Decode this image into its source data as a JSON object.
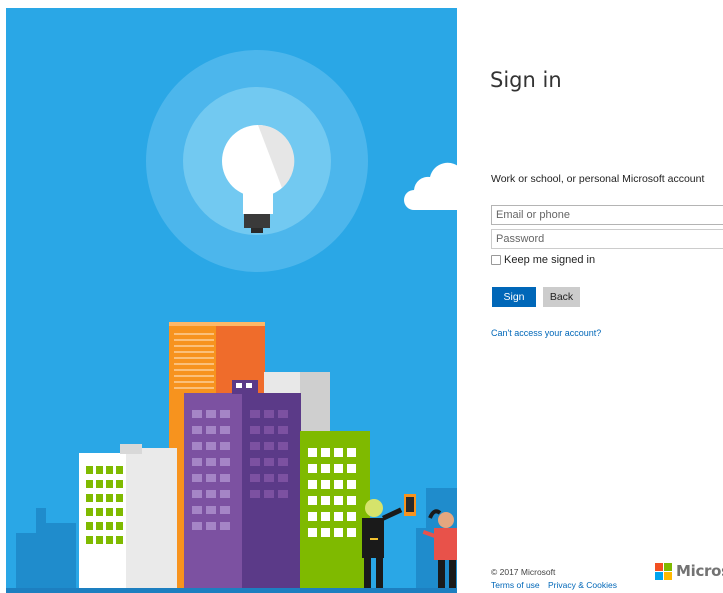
{
  "page": {
    "title": "Sign in",
    "subtitle": "Work or school, or personal Microsoft account"
  },
  "form": {
    "email_placeholder": "Email or phone",
    "password_placeholder": "Password",
    "keep_signed_in_label": "Keep me signed in",
    "signin_label": "Sign in",
    "back_label": "Back",
    "cant_access_link": "Can't access your account?"
  },
  "footer": {
    "copyright": "© 2017 Microsoft",
    "terms_link": "Terms of use",
    "privacy_link": "Privacy & Cookies",
    "brand": "Microsoft"
  },
  "colors": {
    "hero_background": "#2aa7e6",
    "primary_button": "#0067b8",
    "link": "#0067b8",
    "logo_red": "#f25022",
    "logo_green": "#7fba00",
    "logo_blue": "#00a4ef",
    "logo_yellow": "#ffb900"
  },
  "icons": [
    "lightbulb-illustration",
    "cloud-illustration",
    "city-buildings-illustration",
    "microsoft-logo"
  ]
}
